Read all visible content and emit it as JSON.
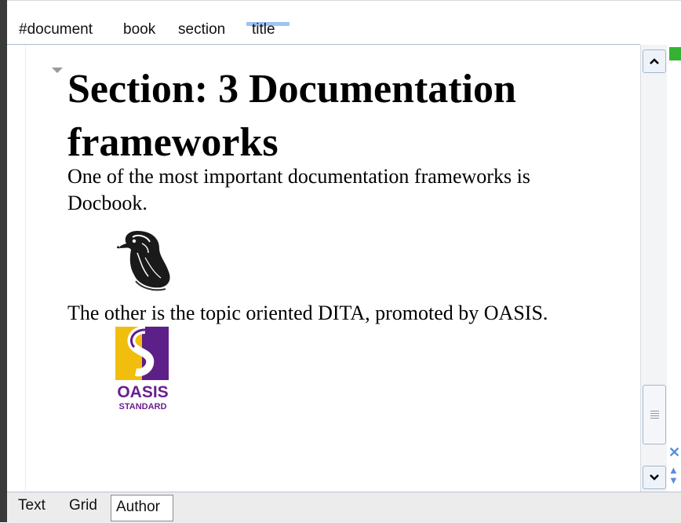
{
  "breadcrumb": {
    "items": [
      "#document",
      "book",
      "section",
      "title"
    ],
    "active_index": 3
  },
  "document": {
    "title": "Section: 3 Documentation frameworks",
    "paragraph1": "One of the most important documentation frameworks is Docbook.",
    "paragraph2": "The other is the topic oriented DITA, promoted by OASIS.",
    "images": {
      "docbook": "docbook-duck-logo",
      "oasis": {
        "icon": "oasis-logo",
        "line1": "OASIS",
        "line2": "STANDARD",
        "purple": "#5d1f88",
        "yellow": "#f2be0e"
      }
    }
  },
  "scrollbar": {
    "up_icon": "chevron-up-icon",
    "down_icon": "chevron-down-icon"
  },
  "side_tools": {
    "close_icon": "close-icon",
    "arrows_icon": "up-down-arrows-icon",
    "status_color": "#34b234"
  },
  "view_modes": {
    "tabs": [
      "Text",
      "Grid",
      "Author"
    ],
    "active": "Author"
  }
}
